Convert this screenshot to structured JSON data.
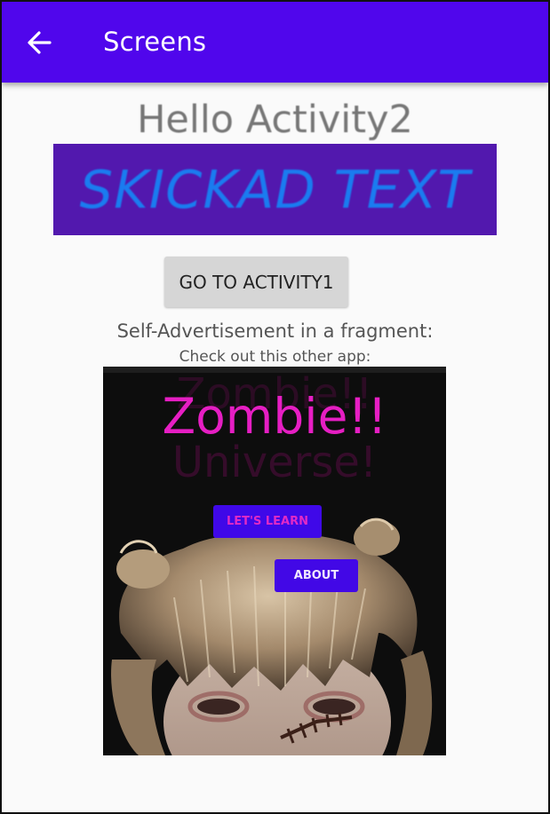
{
  "appbar": {
    "title": "Screens",
    "back_icon": "arrow-left-icon",
    "color": "#5006ec"
  },
  "main": {
    "hello_text": "Hello Activity2",
    "banner_text": "SKICKAD TEXT",
    "banner_bg": "#5218ae",
    "banner_text_color": "#1a7cf0",
    "go_button_label": "GO TO ACTIVITY1",
    "self_ad_text": "Self-Advertisement in a fragment:",
    "check_out_text": "Check out this other app:"
  },
  "promo": {
    "title": "Zombie!!",
    "ghost_line1": "Zombie!!",
    "ghost_line2": "Universe!",
    "lets_learn_label": "LET'S LEARN",
    "about_label": "ABOUT",
    "title_color": "#e61ec3"
  }
}
